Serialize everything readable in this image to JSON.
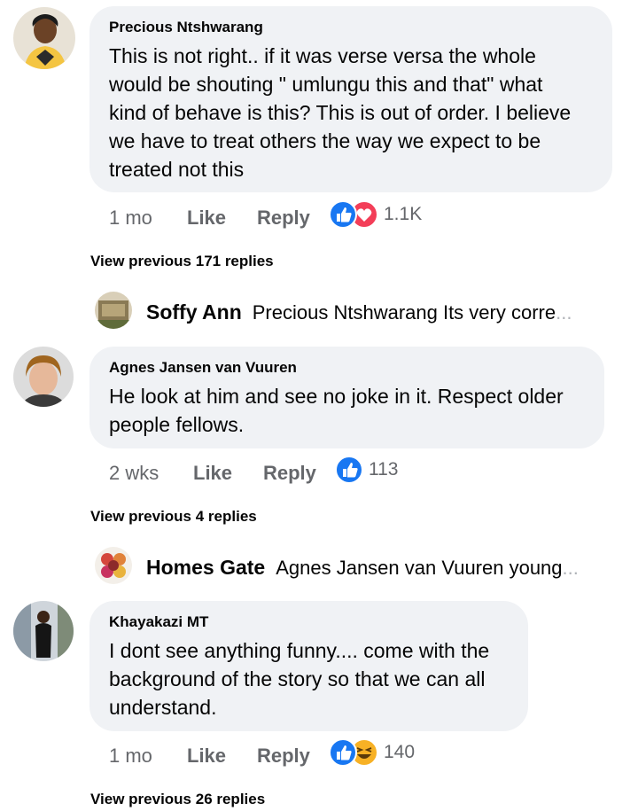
{
  "comments": [
    {
      "author": "Precious Ntshwarang",
      "lines": [
        "This is not right.. if it was verse versa the whole",
        "would be shouting \" umlungu this and that\" what",
        "kind of behave is this? This is out of order. I believe",
        "we have to treat others the way we expect to be",
        "treated not this"
      ],
      "time": "1 mo",
      "like_label": "Like",
      "reply_label": "Reply",
      "reaction_icons": [
        "like-icon",
        "love-icon"
      ],
      "reaction_count": "1.1K",
      "view_previous": "View previous 171 replies",
      "reply": {
        "author": "Soffy Ann",
        "text": "Precious Ntshwarang  Its very corre",
        "ellipsis": "..."
      }
    },
    {
      "author": "Agnes Jansen van Vuuren",
      "lines": [
        "He look at him and see no joke in it. Respect older",
        "people fellows."
      ],
      "time": "2 wks",
      "like_label": "Like",
      "reply_label": "Reply",
      "reaction_icons": [
        "like-icon"
      ],
      "reaction_count": "113",
      "view_previous": "View previous 4 replies",
      "reply": {
        "author": "Homes Gate",
        "text": "Agnes Jansen van Vuuren young",
        "ellipsis": "..."
      }
    },
    {
      "author": "Khayakazi MT",
      "lines": [
        "I dont see anything funny.... come with the",
        "background of the story so that we can all",
        "understand."
      ],
      "time": "1 mo",
      "like_label": "Like",
      "reply_label": "Reply",
      "reaction_icons": [
        "like-icon",
        "haha-icon"
      ],
      "reaction_count": "140",
      "view_previous": "View previous 26 replies"
    }
  ],
  "colors": {
    "bubble": "#f0f2f5",
    "meta_text": "#65676b",
    "like_blue": "#1877f2",
    "love_red": "#f33e58",
    "haha_yellow": "#f7b125"
  }
}
